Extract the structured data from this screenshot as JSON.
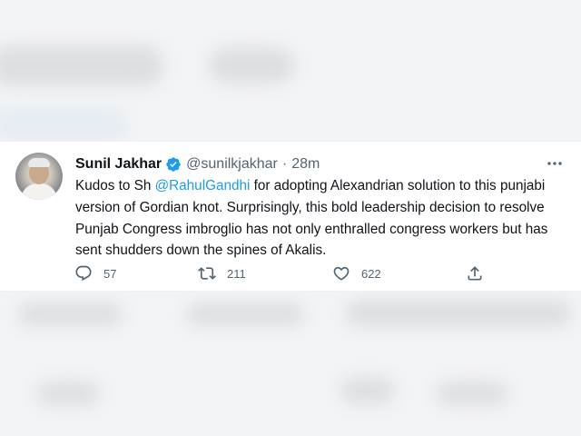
{
  "tweet": {
    "author_name": "Sunil Jakhar",
    "handle": "@sunilkjakhar",
    "separator": "·",
    "time": "28m",
    "text_before": "Kudos to Sh ",
    "mention": "@RahulGandhi",
    "text_after": " for adopting Alexandrian solution to this punjabi version of Gordian knot. Surprisingly, this bold leadership decision to resolve Punjab Congress imbroglio has not only enthralled congress workers but has sent shudders down the spines of Akalis.",
    "replies": "57",
    "retweets": "211",
    "likes": "622"
  },
  "icons": {
    "verified": "verified-badge-icon",
    "more": "more-options-icon",
    "reply": "reply-icon",
    "retweet": "retweet-icon",
    "like": "heart-icon",
    "share": "share-icon"
  },
  "colors": {
    "text": "#0f1419",
    "secondary": "#536471",
    "accent": "#1d9bf0",
    "background_blur": "#f3f4f5"
  }
}
